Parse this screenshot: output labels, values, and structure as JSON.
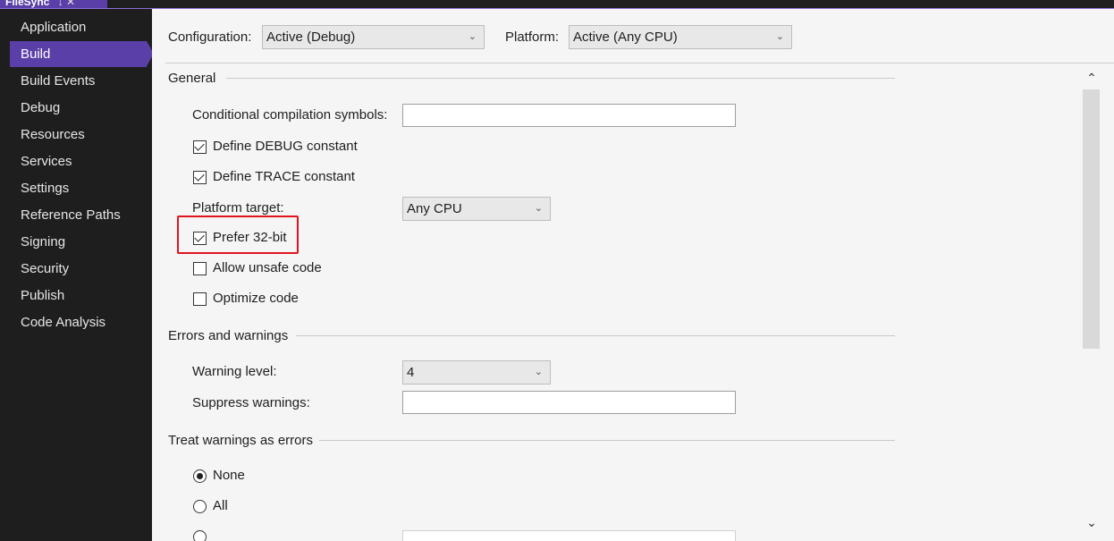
{
  "tab": {
    "title": "FileSync",
    "icons": "↓ ✕"
  },
  "sidebar": {
    "items": [
      {
        "label": "Application"
      },
      {
        "label": "Build",
        "active": true
      },
      {
        "label": "Build Events"
      },
      {
        "label": "Debug"
      },
      {
        "label": "Resources"
      },
      {
        "label": "Services"
      },
      {
        "label": "Settings"
      },
      {
        "label": "Reference Paths"
      },
      {
        "label": "Signing"
      },
      {
        "label": "Security"
      },
      {
        "label": "Publish"
      },
      {
        "label": "Code Analysis"
      }
    ]
  },
  "toolbar": {
    "configuration_label": "Configuration:",
    "configuration_value": "Active (Debug)",
    "platform_label": "Platform:",
    "platform_value": "Active (Any CPU)"
  },
  "general": {
    "title": "General",
    "symbols_label": "Conditional compilation symbols:",
    "symbols_value": "",
    "define_debug": {
      "label": "Define DEBUG constant",
      "checked": true
    },
    "define_trace": {
      "label": "Define TRACE constant",
      "checked": true
    },
    "platform_target_label": "Platform target:",
    "platform_target_value": "Any CPU",
    "prefer32": {
      "label": "Prefer 32-bit",
      "checked": true
    },
    "allow_unsafe": {
      "label": "Allow unsafe code",
      "checked": false
    },
    "optimize": {
      "label": "Optimize code",
      "checked": false
    }
  },
  "errors": {
    "title": "Errors and warnings",
    "warning_level_label": "Warning level:",
    "warning_level_value": "4",
    "suppress_label": "Suppress warnings:",
    "suppress_value": ""
  },
  "treat": {
    "title": "Treat warnings as errors",
    "none": {
      "label": "None",
      "selected": true
    },
    "all": {
      "label": "All",
      "selected": false
    }
  },
  "colors": {
    "accent": "#5a3fa8",
    "highlight": "#e0141e"
  }
}
